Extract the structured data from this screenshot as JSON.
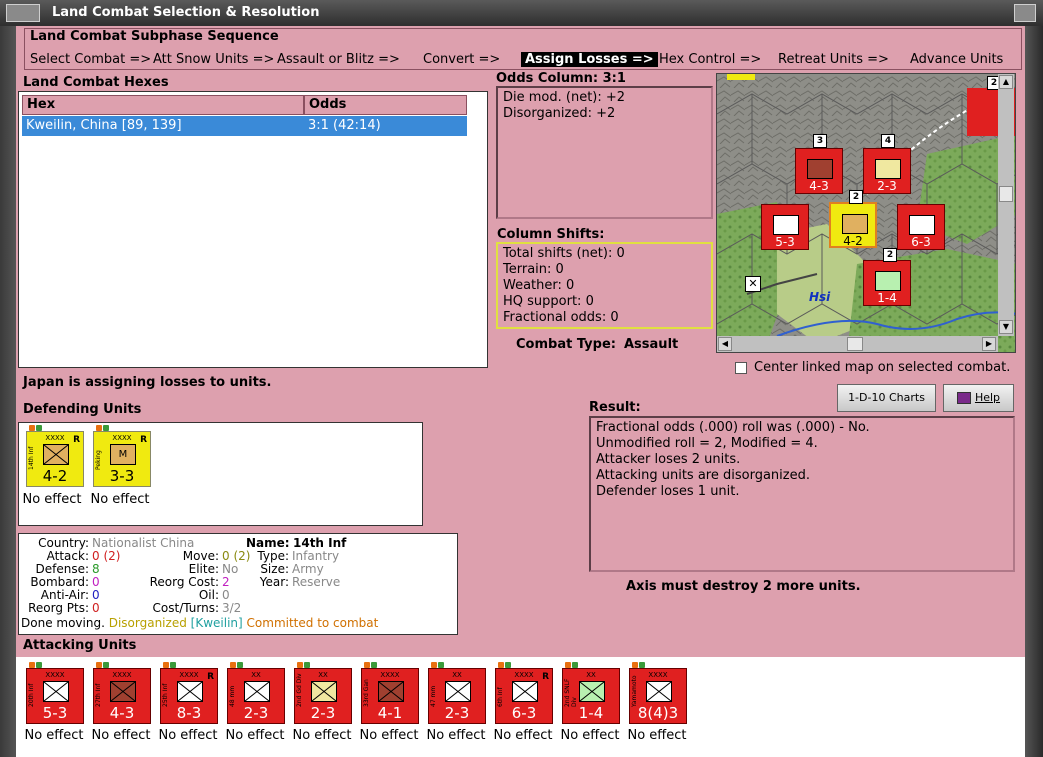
{
  "window": {
    "title": "Land Combat Selection & Resolution"
  },
  "sequence": {
    "title": "Land Combat Subphase Sequence",
    "steps": [
      {
        "label": "Select Combat =>",
        "active": false
      },
      {
        "label": "Att Snow Units =>",
        "active": false
      },
      {
        "label": "Assault or Blitz =>",
        "active": false
      },
      {
        "label": "Convert =>",
        "active": false
      },
      {
        "label": "Assign Losses =>",
        "active": true
      },
      {
        "label": "Hex Control =>",
        "active": false
      },
      {
        "label": "Retreat Units =>",
        "active": false
      },
      {
        "label": "Advance Units",
        "active": false
      }
    ]
  },
  "hexes_panel": {
    "title": "Land Combat Hexes",
    "columns": [
      "Hex",
      "Odds"
    ],
    "rows": [
      {
        "hex": "Kweilin, China [89, 139]",
        "odds": "3:1 (42:14)"
      }
    ]
  },
  "odds_column": {
    "title": "Odds Column: 3:1",
    "lines": [
      "Die mod. (net): +2",
      "Disorganized: +2"
    ]
  },
  "column_shifts": {
    "title": "Column Shifts:",
    "lines": [
      "Total shifts (net): 0",
      "Terrain: 0",
      "Weather: 0",
      "HQ support: 0",
      "Fractional odds: 0"
    ]
  },
  "combat_type": {
    "label": "Combat Type:",
    "value": "Assault"
  },
  "map": {
    "place_label": "Hsi",
    "center_checkbox_label": "Center linked map on selected combat.",
    "center_checked": false,
    "stack_counts": [
      "2",
      "3",
      "4",
      "2",
      "2"
    ]
  },
  "status_message": "Japan is assigning losses to units.",
  "buttons": {
    "charts": "1-D-10 Charts",
    "help": "Help"
  },
  "result": {
    "title": "Result:",
    "lines": [
      "Fractional odds (.000) roll was (.000)  - No.",
      "Unmodified roll = 2, Modified = 4.",
      "Attacker loses 2 units.",
      "Attacking units are disorganized.",
      "Defender loses 1 unit."
    ],
    "footer": "Axis must destroy 2 more units."
  },
  "defending": {
    "title": "Defending Units",
    "units": [
      {
        "name": "14th Inf",
        "size": "XXXX",
        "strength": "4-2",
        "reserve": "R",
        "effect": "No effect"
      },
      {
        "name": "Peking",
        "size": "XXXX",
        "strength": "3-3",
        "reserve": "R",
        "effect": "No effect",
        "symbol_text": "M"
      }
    ]
  },
  "unit_info": {
    "country_label": "Country:",
    "country": "Nationalist China",
    "attack_label": "Attack:",
    "attack": "0 (2)",
    "defense_label": "Defense:",
    "defense": "8",
    "bombard_label": "Bombard:",
    "bombard": "0",
    "antiair_label": "Anti-Air:",
    "antiair": "0",
    "reorgpts_label": "Reorg Pts:",
    "reorgpts": "0",
    "move_label": "Move:",
    "move": "0 (2)",
    "elite_label": "Elite:",
    "elite": "No",
    "reorgcost_label": "Reorg Cost:",
    "reorgcost": "2",
    "oil_label": "Oil:",
    "oil": "0",
    "costturns_label": "Cost/Turns:",
    "costturns": "3/2",
    "name_label": "Name:",
    "name": "14th Inf",
    "type_label": "Type:",
    "type": "Infantry",
    "size_label": "Size:",
    "size": "Army",
    "year_label": "Year:",
    "year": "Reserve",
    "done": "Done moving.",
    "disorg": "Disorganized",
    "place": "[Kweilin]",
    "committed": "Committed to combat"
  },
  "attacking": {
    "title": "Attacking Units",
    "units": [
      {
        "name": "20th Inf",
        "size": "XXXX",
        "strength": "5-3",
        "effect": "No effect",
        "sym": "white"
      },
      {
        "name": "27th Inf",
        "size": "XXXX",
        "strength": "4-3",
        "effect": "No effect",
        "sym": "brown"
      },
      {
        "name": "25th Inf",
        "size": "XXXX",
        "strength": "8-3",
        "reserve": "R",
        "effect": "No effect",
        "sym": "white"
      },
      {
        "name": "48 mm",
        "size": "XX",
        "strength": "2-3",
        "effect": "No effect",
        "sym": "white"
      },
      {
        "name": "2nd Gd Div",
        "size": "XX",
        "strength": "2-3",
        "effect": "No effect",
        "sym": "cream"
      },
      {
        "name": "33rd Gan",
        "size": "XXXX",
        "strength": "4-1",
        "effect": "No effect",
        "sym": "brown"
      },
      {
        "name": "47 mm",
        "size": "XX",
        "strength": "2-3",
        "effect": "No effect",
        "sym": "white"
      },
      {
        "name": "6th Inf",
        "size": "XXXX",
        "strength": "6-3",
        "reserve": "R",
        "effect": "No effect",
        "sym": "white"
      },
      {
        "name": "2nd SNLF Div",
        "size": "XX",
        "strength": "1-4",
        "effect": "No effect",
        "sym": "green"
      },
      {
        "name": "Yamamoto",
        "size": "XXXX",
        "strength": "8(4)3",
        "effect": "No effect",
        "sym": "white"
      }
    ]
  }
}
